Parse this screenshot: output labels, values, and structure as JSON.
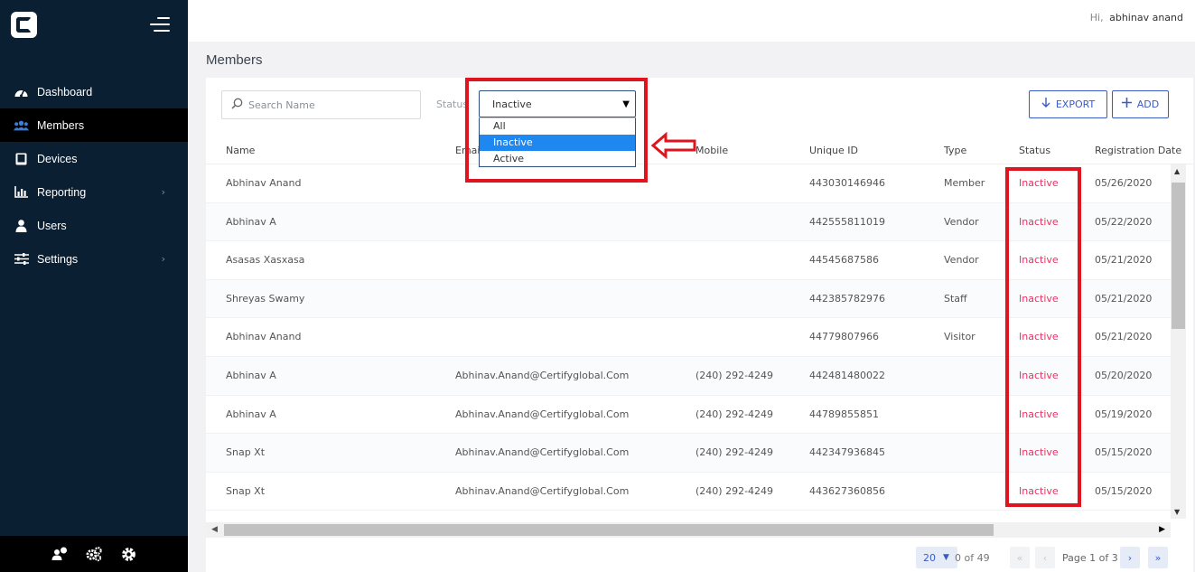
{
  "sidebar": {
    "logo_letter": "C",
    "items": [
      {
        "label": "Dashboard",
        "icon": "dashboard-gauge-icon",
        "active": false,
        "has_submenu": false
      },
      {
        "label": "Members",
        "icon": "members-group-icon",
        "active": true,
        "has_submenu": false
      },
      {
        "label": "Devices",
        "icon": "tablet-device-icon",
        "active": false,
        "has_submenu": false
      },
      {
        "label": "Reporting",
        "icon": "bar-chart-icon",
        "active": false,
        "has_submenu": true
      },
      {
        "label": "Users",
        "icon": "user-icon",
        "active": false,
        "has_submenu": false
      },
      {
        "label": "Settings",
        "icon": "sliders-icon",
        "active": false,
        "has_submenu": true
      }
    ],
    "bottom_icons": [
      "user-chat-icon",
      "cogs-icon",
      "gear-icon"
    ]
  },
  "header": {
    "greeting_prefix": "Hi,",
    "user_name": "abhinav anand"
  },
  "page": {
    "title": "Members"
  },
  "toolbar": {
    "search_placeholder": "Search Name",
    "status_label": "Status",
    "status_selected": "Inactive",
    "status_options": [
      "All",
      "Inactive",
      "Active"
    ],
    "export_label": "EXPORT",
    "add_label": "ADD"
  },
  "table": {
    "columns": [
      "Name",
      "Email",
      "Mobile",
      "Unique ID",
      "Type",
      "Status",
      "Registration Date"
    ],
    "rows": [
      {
        "name": "Abhinav Anand",
        "email": "",
        "mobile": "",
        "unique_id": "443030146946",
        "type": "Member",
        "status": "Inactive",
        "registration_date": "05/26/2020"
      },
      {
        "name": "Abhinav A",
        "email": "",
        "mobile": "",
        "unique_id": "442555811019",
        "type": "Vendor",
        "status": "Inactive",
        "registration_date": "05/22/2020"
      },
      {
        "name": "Asasas Xasxasa",
        "email": "",
        "mobile": "",
        "unique_id": "44545687586",
        "type": "Vendor",
        "status": "Inactive",
        "registration_date": "05/21/2020"
      },
      {
        "name": "Shreyas Swamy",
        "email": "",
        "mobile": "",
        "unique_id": "442385782976",
        "type": "Staff",
        "status": "Inactive",
        "registration_date": "05/21/2020"
      },
      {
        "name": "Abhinav Anand",
        "email": "",
        "mobile": "",
        "unique_id": "44779807966",
        "type": "Visitor",
        "status": "Inactive",
        "registration_date": "05/21/2020"
      },
      {
        "name": "Abhinav A",
        "email": "Abhinav.Anand@Certifyglobal.Com",
        "mobile": "(240) 292-4249",
        "unique_id": "442481480022",
        "type": "",
        "status": "Inactive",
        "registration_date": "05/20/2020"
      },
      {
        "name": "Abhinav A",
        "email": "Abhinav.Anand@Certifyglobal.Com",
        "mobile": "(240) 292-4249",
        "unique_id": "44789855851",
        "type": "",
        "status": "Inactive",
        "registration_date": "05/19/2020"
      },
      {
        "name": "Snap Xt",
        "email": "Abhinav.Anand@Certifyglobal.Com",
        "mobile": "(240) 292-4249",
        "unique_id": "442347936845",
        "type": "",
        "status": "Inactive",
        "registration_date": "05/15/2020"
      },
      {
        "name": "Snap Xt",
        "email": "Abhinav.Anand@Certifyglobal.Com",
        "mobile": "(240) 292-4249",
        "unique_id": "443627360856",
        "type": "",
        "status": "Inactive",
        "registration_date": "05/15/2020"
      }
    ]
  },
  "pagination": {
    "page_size": "20",
    "total_text": "0 of 49",
    "page_text": "Page 1 of 3"
  },
  "colors": {
    "sidebar_bg": "#0b1f33",
    "accent": "#3a5bc7",
    "status_inactive": "#e53563",
    "annotation": "#e0141e",
    "selected_option": "#1e87f0"
  }
}
